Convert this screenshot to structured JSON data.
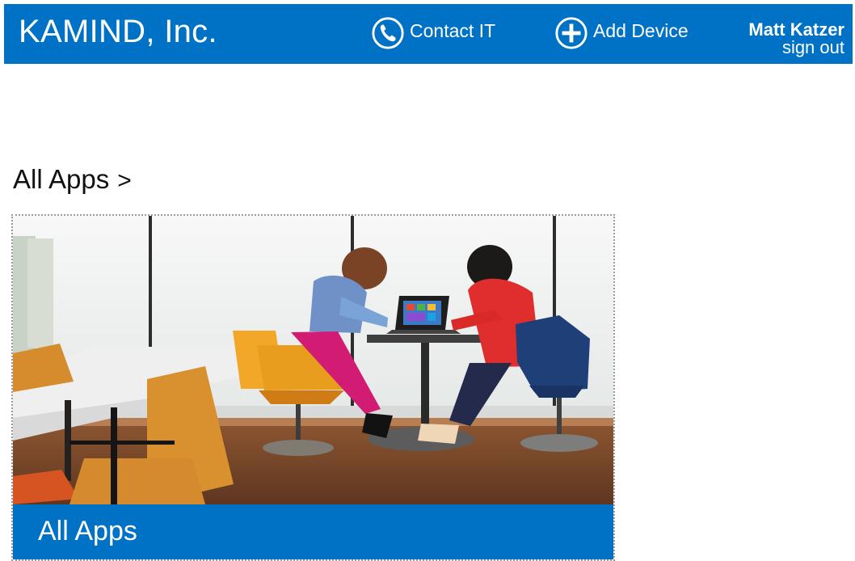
{
  "header": {
    "company": "KAMIND, Inc.",
    "contact_label": "Contact IT",
    "contact_icon": "phone-circle-icon",
    "add_device_label": "Add Device",
    "add_device_icon": "plus-circle-icon",
    "user_name": "Matt Katzer",
    "sign_out": "sign out"
  },
  "main": {
    "heading": "All Apps",
    "heading_chevron": ">",
    "tile": {
      "caption": "All Apps",
      "image_description": "two people at a laptop in a cafe"
    }
  },
  "colors": {
    "brand_blue": "#0072c6",
    "background": "#ffffff",
    "text": "#111111"
  }
}
